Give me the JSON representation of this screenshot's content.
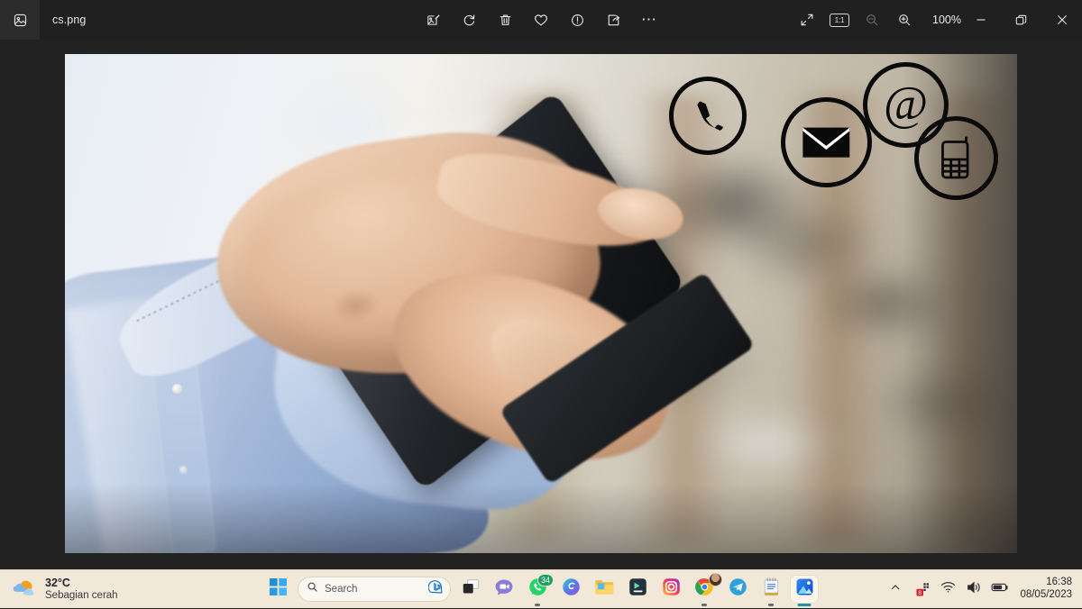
{
  "window": {
    "tab_icon": "photo-icon",
    "filename": "cs.png",
    "toolbar": [
      {
        "name": "edit-image-button",
        "icon": "edit-image-icon",
        "label": "Edit image"
      },
      {
        "name": "rotate-button",
        "icon": "rotate-icon",
        "label": "Rotate"
      },
      {
        "name": "delete-button",
        "icon": "trash-icon",
        "label": "Delete"
      },
      {
        "name": "favorite-button",
        "icon": "heart-icon",
        "label": "Add to favorites"
      },
      {
        "name": "info-button",
        "icon": "info-icon",
        "label": "File info"
      },
      {
        "name": "share-button",
        "icon": "share-icon",
        "label": "Share"
      },
      {
        "name": "more-options-button",
        "icon": "ellipsis-icon",
        "label": "See more"
      }
    ],
    "view_controls": {
      "fullscreen_label": "Fullscreen",
      "actual_size_label": "1:1",
      "zoom_out_label": "Zoom out",
      "zoom_in_label": "Zoom in",
      "zoom_level": "100%"
    },
    "window_controls": {
      "minimize": "—",
      "restore": "Restore",
      "close": "✕"
    },
    "colors": {
      "titlebar_bg": "#202020",
      "tab_bg": "#2c2c2c",
      "canvas_bg": "#222222",
      "taskbar_bg": "#f2e8d8",
      "close_hover": "#c42b1c"
    }
  },
  "photo": {
    "description": "Hand in light blue shirt tapping a black smartphone, blurred office background",
    "overlay_icons": [
      {
        "name": "telephone-icon",
        "label": "Telephone"
      },
      {
        "name": "envelope-icon",
        "label": "Email"
      },
      {
        "name": "at-sign-icon",
        "label": "At sign"
      },
      {
        "name": "mobile-phone-icon",
        "label": "Mobile phone"
      }
    ]
  },
  "taskbar": {
    "weather": {
      "icon": "sun-cloud-icon",
      "temperature": "32°C",
      "condition": "Sebagian cerah"
    },
    "start_label": "Start",
    "search": {
      "icon": "search-icon",
      "placeholder": "Search",
      "assistant_icon": "bing-chat-icon"
    },
    "apps": [
      {
        "name": "task-view-button",
        "icon": "task-view-icon",
        "label": "Task view",
        "badge": null,
        "active": false
      },
      {
        "name": "chat-button",
        "icon": "chat-video-icon",
        "label": "Chat",
        "badge": null,
        "active": false
      },
      {
        "name": "whatsapp-button",
        "icon": "whatsapp-icon",
        "label": "WhatsApp",
        "badge": "34",
        "active": false,
        "running": true
      },
      {
        "name": "copilot-button",
        "icon": "copilot-icon",
        "label": "Copilot",
        "badge": null,
        "active": false
      },
      {
        "name": "file-explorer-button",
        "icon": "folder-icon",
        "label": "File Explorer",
        "badge": null,
        "active": false
      },
      {
        "name": "video-editor-button",
        "icon": "video-editor-icon",
        "label": "Video editor",
        "badge": null,
        "active": false
      },
      {
        "name": "instagram-button",
        "icon": "instagram-icon",
        "label": "Instagram",
        "badge": null,
        "active": false
      },
      {
        "name": "chrome-button",
        "icon": "chrome-icon",
        "label": "Google Chrome",
        "badge": "avatar",
        "active": false,
        "running": true
      },
      {
        "name": "telegram-button",
        "icon": "telegram-icon",
        "label": "Telegram",
        "badge": null,
        "active": false
      },
      {
        "name": "notepad-button",
        "icon": "notepad-icon",
        "label": "Notepad",
        "badge": null,
        "active": false,
        "running": true
      },
      {
        "name": "photos-button",
        "icon": "photos-icon",
        "label": "Photos",
        "badge": null,
        "active": true
      }
    ],
    "tray": {
      "chevron_label": "Show hidden icons",
      "hidden_app_icon": "red-app-icon",
      "wifi_label": "Network",
      "volume_label": "Volume",
      "battery_label": "Battery",
      "time": "16:38",
      "date": "08/05/2023"
    }
  }
}
